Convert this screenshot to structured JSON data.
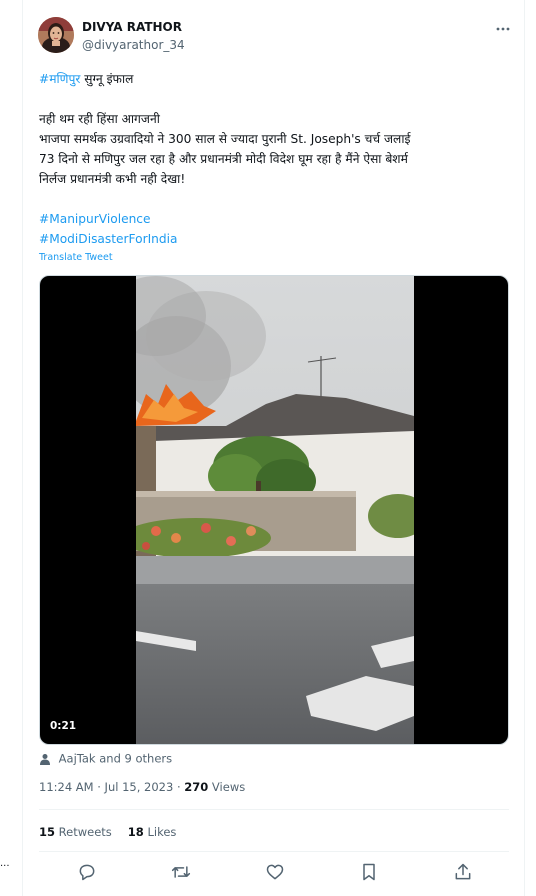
{
  "tweet": {
    "author": {
      "name": "DIVYA RATHOR",
      "handle": "@divyarathor_34"
    },
    "menu_icon": "more-dots-icon",
    "body": {
      "line1_hashtag": "#मणिपुर",
      "line1_rest": " सुग्नू इंफाल",
      "line2": "नही थम रही हिंसा आगजनी",
      "line3": "भाजपा समर्थक उग्रवादियो ने 300 साल से ज्यादा पुरानी St. Joseph's चर्च जलाई",
      "line4": "73 दिनो से मणिपुर जल रहा है और प्रधानमंत्री मोदी विदेश घूम रहा है मैंने ऐसा बेशर्म",
      "line5": "निर्लज प्रधानमंत्री कभी नही देखा!",
      "hashtag1": "#ManipurViolence",
      "hashtag2": "#ModiDisasterForIndia"
    },
    "translate_label": "Translate Tweet",
    "video": {
      "duration": "0:21"
    },
    "tagged": "AajTak and 9 others",
    "timestamp": "11:24 AM · Jul 15, 2023 · ",
    "views_count": "270",
    "views_label": " Views",
    "retweets_count": "15",
    "retweets_label": " Retweets",
    "likes_count": "18",
    "likes_label": " Likes",
    "actions": [
      {
        "icon": "reply-icon"
      },
      {
        "icon": "retweet-icon"
      },
      {
        "icon": "like-icon"
      },
      {
        "icon": "bookmark-icon"
      },
      {
        "icon": "share-icon"
      }
    ],
    "colors": {
      "link": "#1d9bf0",
      "secondary": "#536471",
      "text": "#0f1419",
      "divider": "#eff3f4"
    }
  },
  "left_edge_text": "..."
}
